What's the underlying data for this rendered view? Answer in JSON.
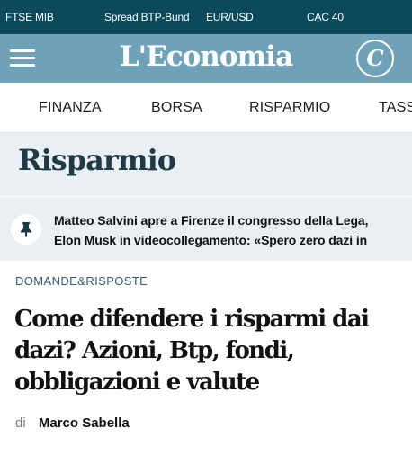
{
  "ticker": {
    "items": [
      "FTSE MIB",
      "Spread BTP-Bund",
      "EUR/USD",
      "CAC 40"
    ]
  },
  "header": {
    "logo": "L'Economia",
    "corriere_button": "C"
  },
  "nav": {
    "items": [
      "FINANZA",
      "BORSA",
      "RISPARMIO",
      "TASS"
    ]
  },
  "section": {
    "title": "Risparmio"
  },
  "breaking": {
    "icon": "pin-icon",
    "line1": "Matteo Salvini apre a Firenze il congresso della Lega,",
    "line2": "Elon Musk in videocollegamento: «Spero zero dazi in"
  },
  "article": {
    "kicker": "DOMANDE&RISPOSTE",
    "headline": "Come difendere i risparmi dai dazi? Azioni, Btp, fondi, obbligazioni e valute",
    "byline_prefix": "di",
    "author": "Marco Sabella"
  },
  "colors": {
    "ticker_bg": "#0b4a5c",
    "header_bg": "#6fa2b8",
    "section_bg": "#e9eff3",
    "section_title": "#1d3a47"
  }
}
